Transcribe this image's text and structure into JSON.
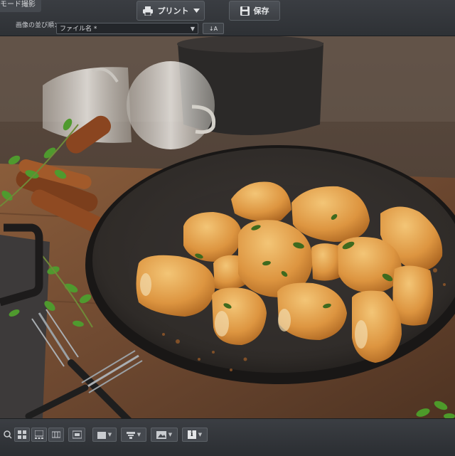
{
  "toolbar_top": {
    "mode_tab_label": "モード撮影",
    "print_label": "プリント",
    "save_label": "保存",
    "sort_label": "画像の並び順：",
    "sort_value": "ファイル名 *",
    "sort_order_label": "↓A"
  },
  "icons": {
    "print": "printer-icon",
    "save": "floppy-disk-icon",
    "sort_order": "sort-ascending-icon",
    "info": "info-icon"
  },
  "toolbar_bottom": {
    "info_label": "i"
  },
  "colors": {
    "toolbar": "#2e3135",
    "plate": "#3a3532",
    "table": "#6e4c33",
    "food": "#e6a94e"
  }
}
